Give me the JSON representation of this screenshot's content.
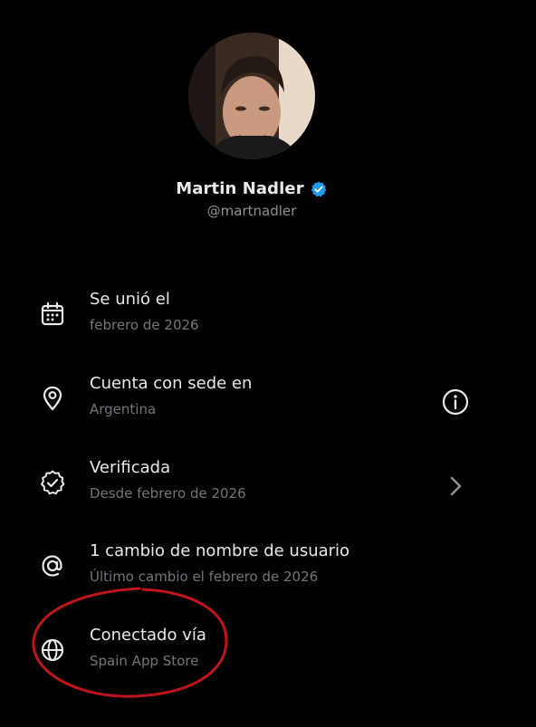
{
  "profile": {
    "display_name": "Martin Nadler",
    "handle": "@martnadler",
    "verified_badge_color": "#1d9bf0"
  },
  "info_rows": [
    {
      "icon": "calendar-icon",
      "title": "Se unió el",
      "subtitle": "febrero de 2026",
      "action": null
    },
    {
      "icon": "location-pin-icon",
      "title": "Cuenta con sede en",
      "subtitle": "Argentina",
      "action": "info-icon"
    },
    {
      "icon": "verified-check-icon",
      "title": "Verificada",
      "subtitle": "Desde febrero de 2026",
      "action": "chevron-right-icon"
    },
    {
      "icon": "at-sign-icon",
      "title": "1 cambio de nombre de usuario",
      "subtitle": "Último cambio el febrero de 2026",
      "action": null
    },
    {
      "icon": "globe-icon",
      "title": "Conectado vía",
      "subtitle": "Spain App Store",
      "action": null
    }
  ],
  "colors": {
    "background": "#000000",
    "primary_text": "#e7e9ea",
    "secondary_text": "#71767b",
    "annotation": "#c0141c"
  }
}
